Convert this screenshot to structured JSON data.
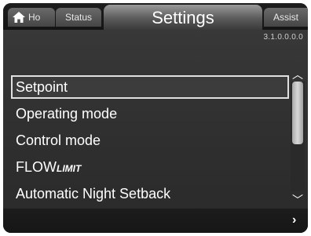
{
  "header": {
    "tabs": [
      {
        "label": "Ho",
        "icon": "home-icon"
      },
      {
        "label": "Status"
      },
      {
        "label": "Assist"
      }
    ],
    "title": "Settings",
    "menu_id": "3.1.0.0.0.0"
  },
  "menu": {
    "items": [
      {
        "label": "Setpoint",
        "selected": true
      },
      {
        "label": "Operating mode"
      },
      {
        "label": "Control mode"
      },
      {
        "label": "FLOW",
        "suffix": "LIMIT"
      },
      {
        "label": "Automatic Night Setback"
      }
    ]
  },
  "scroll": {
    "up_icon": "chevron-up-icon",
    "down_icon": "chevron-down-icon"
  },
  "nav": {
    "next_icon": "chevron-right-icon"
  },
  "colors": {
    "background": "#2f2f2f",
    "text": "#ffffff",
    "selection_border": "#e0e0e0"
  }
}
